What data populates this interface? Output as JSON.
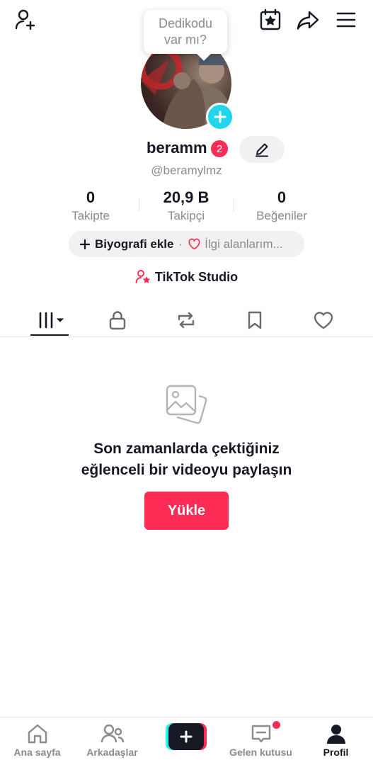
{
  "top_bar": {
    "icons": [
      "add-user-icon",
      "calendar-star-icon",
      "share-icon",
      "menu-icon"
    ]
  },
  "bubble": {
    "line1": "Dedikodu",
    "line2": "var mı?"
  },
  "profile": {
    "username": "beramm",
    "notification_count": "2",
    "handle": "@beramylmz"
  },
  "stats": [
    {
      "value": "0",
      "label": "Takipte"
    },
    {
      "value": "20,9 B",
      "label": "Takipçi"
    },
    {
      "value": "0",
      "label": "Beğeniler"
    }
  ],
  "bio": {
    "add_label": "Biyografi ekle",
    "separator": "·",
    "interests_label": "İlgi alanlarım..."
  },
  "studio": {
    "label": "TikTok Studio"
  },
  "tabs": [
    "videos-grid-icon",
    "lock-icon",
    "repost-icon",
    "bookmark-icon",
    "heart-icon"
  ],
  "empty_state": {
    "line1": "Son zamanlarda çektiğiniz",
    "line2": "eğlenceli bir videoyu paylaşın",
    "button": "Yükle"
  },
  "bottom_nav": {
    "home": "Ana sayfa",
    "friends": "Arkadaşlar",
    "inbox": "Gelen kutusu",
    "profile": "Profil"
  },
  "colors": {
    "brand_red": "#fe2c55",
    "brand_cyan": "#25f4ee",
    "avatar_plus": "#20d5ec",
    "text_primary": "#161823",
    "text_secondary": "#8a8b91"
  }
}
